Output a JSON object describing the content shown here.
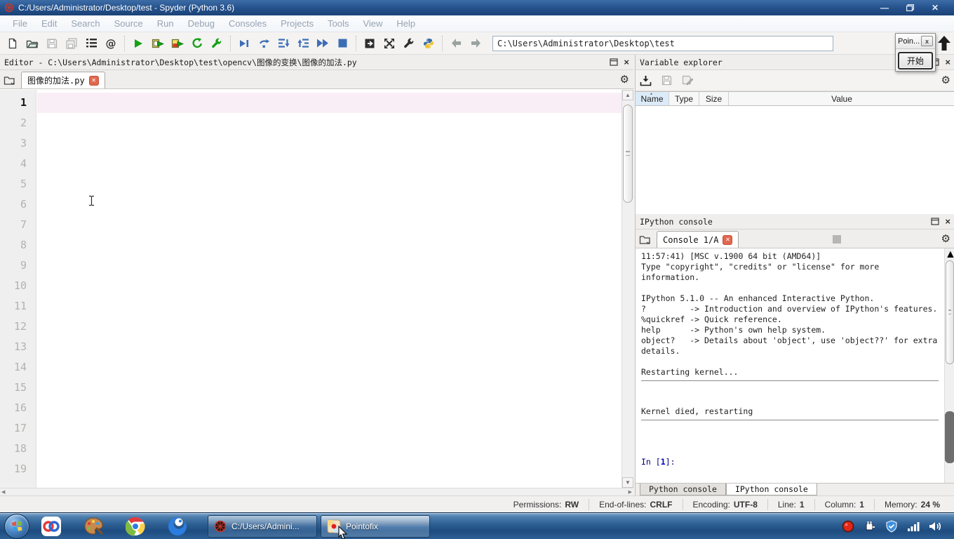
{
  "window": {
    "title": "C:/Users/Administrator/Desktop/test - Spyder (Python 3.6)"
  },
  "menu": {
    "items": [
      "File",
      "Edit",
      "Search",
      "Source",
      "Run",
      "Debug",
      "Consoles",
      "Projects",
      "Tools",
      "View",
      "Help"
    ]
  },
  "toolbar": {
    "path_value": "C:\\Users\\Administrator\\Desktop\\test"
  },
  "pointofix": {
    "title": "Poin...",
    "close_label": "x",
    "start_label": "开始"
  },
  "editor": {
    "pane_title": "Editor - C:\\Users\\Administrator\\Desktop\\test\\opencv\\图像的变换\\图像的加法.py",
    "tab_label": "图像的加法.py",
    "line_numbers": [
      "1",
      "2",
      "3",
      "4",
      "5",
      "6",
      "7",
      "8",
      "9",
      "10",
      "11",
      "12",
      "13",
      "14",
      "15",
      "16",
      "17",
      "18",
      "19"
    ]
  },
  "variable_explorer": {
    "pane_title": "Variable explorer",
    "columns": [
      "Name",
      "Type",
      "Size",
      "Value"
    ]
  },
  "console": {
    "pane_title": "IPython console",
    "tab_label": "Console 1/A",
    "lines": [
      "11:57:41) [MSC v.1900 64 bit (AMD64)]",
      "Type \"copyright\", \"credits\" or \"license\" for more",
      "information.",
      "",
      "IPython 5.1.0 -- An enhanced Interactive Python.",
      "?         -> Introduction and overview of IPython's features.",
      "%quickref -> Quick reference.",
      "help      -> Python's own help system.",
      "object?   -> Details about 'object', use 'object??' for extra",
      "details.",
      "",
      "Restarting kernel..."
    ],
    "kernel_died": "Kernel died, restarting",
    "prompt": {
      "pre": "In [",
      "num": "1",
      "post": "]:"
    },
    "bottom_tabs": [
      "Python console",
      "IPython console"
    ]
  },
  "status": {
    "segments": [
      {
        "label": "Permissions:",
        "value": "RW"
      },
      {
        "label": "End-of-lines:",
        "value": "CRLF"
      },
      {
        "label": "Encoding:",
        "value": "UTF-8"
      },
      {
        "label": "Line:",
        "value": "1"
      },
      {
        "label": "Column:",
        "value": "1"
      },
      {
        "label": "Memory:",
        "value": "24 %"
      }
    ]
  },
  "taskbar": {
    "buttons": [
      {
        "label": "C:/Users/Admini..."
      },
      {
        "label": "Pointofix"
      }
    ]
  }
}
